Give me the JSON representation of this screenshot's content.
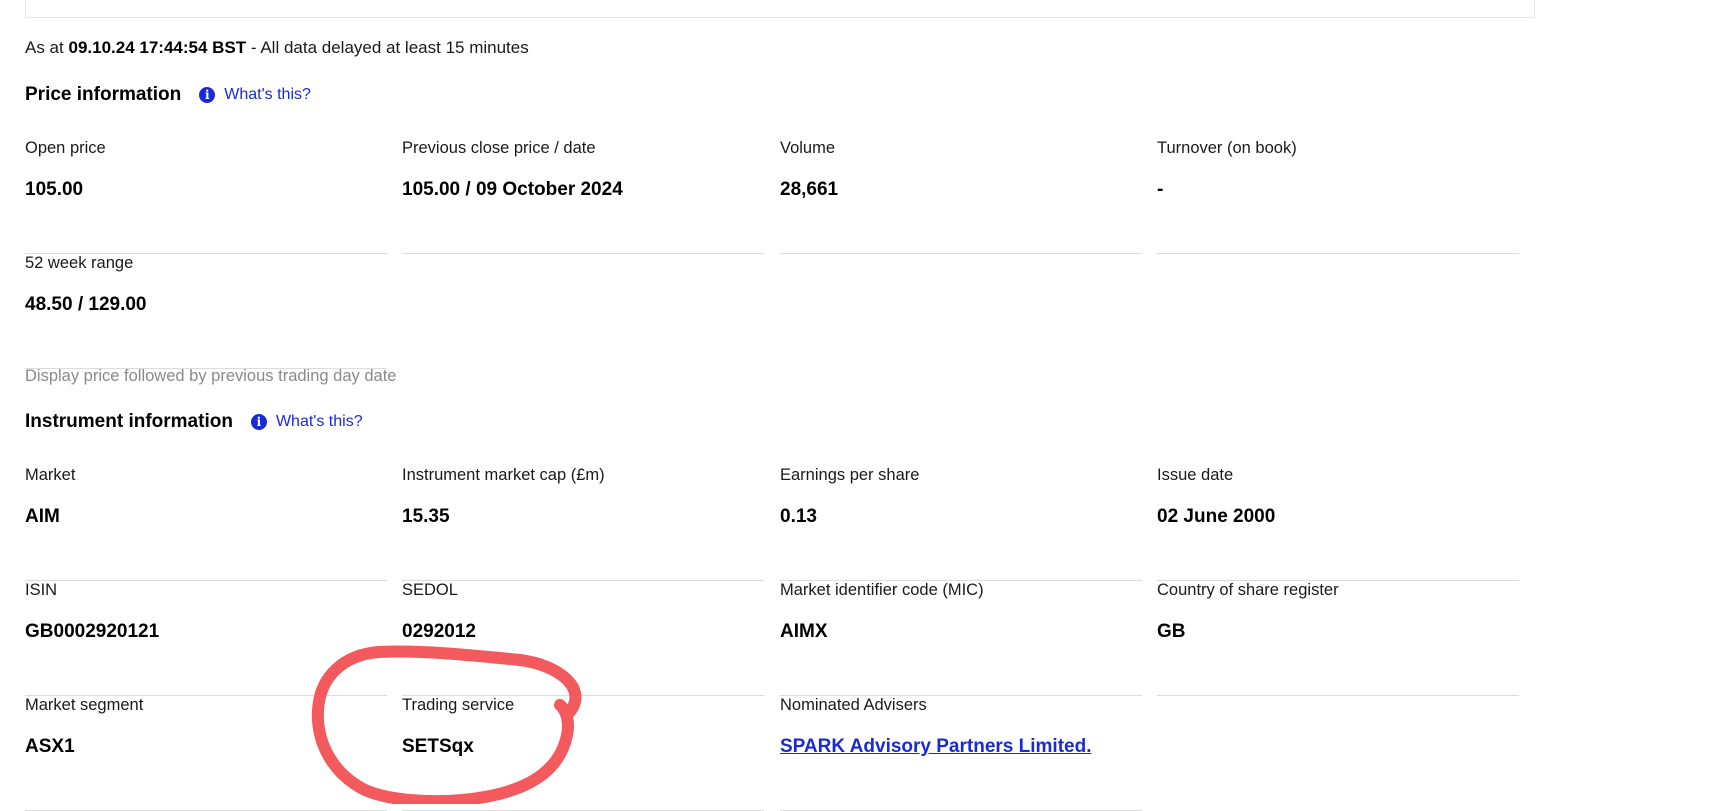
{
  "header": {
    "as_at_prefix": "As at",
    "as_at_timestamp": "09.10.24 17:44:54 BST",
    "as_at_suffix": "- All data delayed at least 15 minutes"
  },
  "price_section": {
    "title": "Price information",
    "info_icon": "info-circle-icon",
    "whats_this": "What's this?",
    "fields": [
      {
        "label": "Open price",
        "value": "105.00"
      },
      {
        "label": "Previous close price / date",
        "value": "105.00 / 09 October 2024"
      },
      {
        "label": "Volume",
        "value": "28,661"
      },
      {
        "label": "Turnover (on book)",
        "value": "-"
      },
      {
        "label": "52 week range",
        "value": "48.50 / 129.00"
      }
    ],
    "note": "Display price followed by previous trading day date"
  },
  "instrument_section": {
    "title": "Instrument information",
    "info_icon": "info-circle-icon",
    "whats_this": "What's this?",
    "fields": [
      {
        "label": "Market",
        "value": "AIM"
      },
      {
        "label": "Instrument market cap (£m)",
        "value": "15.35"
      },
      {
        "label": "Earnings per share",
        "value": "0.13"
      },
      {
        "label": "Issue date",
        "value": "02 June 2000"
      },
      {
        "label": "ISIN",
        "value": "GB0002920121"
      },
      {
        "label": "SEDOL",
        "value": "0292012"
      },
      {
        "label": "Market identifier code (MIC)",
        "value": "AIMX"
      },
      {
        "label": "Country of share register",
        "value": "GB"
      },
      {
        "label": "Market segment",
        "value": "ASX1"
      },
      {
        "label": "Trading service",
        "value": "SETSqx"
      },
      {
        "label": "Nominated Advisers",
        "value": "SPARK Advisory Partners Limited."
      }
    ]
  },
  "colors": {
    "link": "#1a2ad6",
    "annotation": "#f25a5e",
    "divider": "#dcdcdc",
    "muted_text": "#8a8a8a"
  }
}
